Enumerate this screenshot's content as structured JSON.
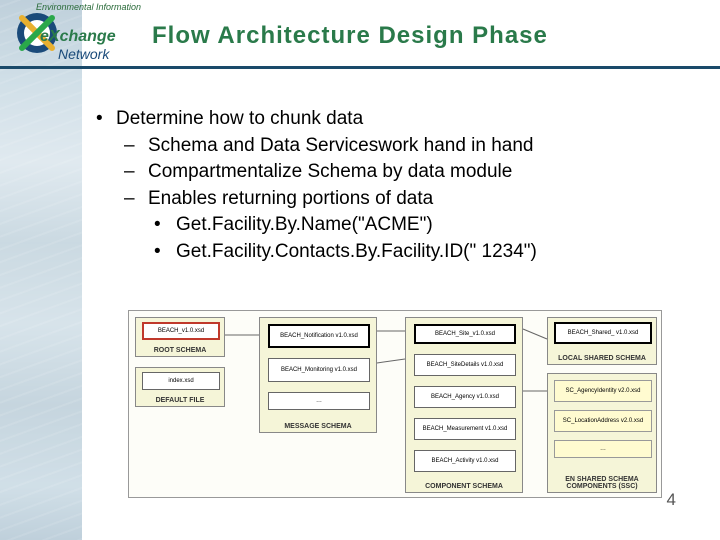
{
  "header": {
    "env_text": "Environmental Information",
    "logo_brand": "eXchange",
    "logo_sub": "Network",
    "title": "Flow Architecture Design Phase"
  },
  "bullets": {
    "b1": "Determine how to chunk data",
    "d1": "Schema and Data Serviceswork hand in hand",
    "d2": "Compartmentalize Schema by data module",
    "d3": "Enables returning portions of data",
    "s1": "Get.Facility.By.Name(\"ACME\")",
    "s2": "Get.Facility.Contacts.By.Facility.ID(\" 1234\")"
  },
  "diagram": {
    "g1": {
      "label": "ROOT SCHEMA",
      "box1": "BEACH_v1.0.xsd"
    },
    "g2": {
      "label": "DEFAULT FILE",
      "box1": "index.xsd"
    },
    "g3": {
      "label": "MESSAGE SCHEMA",
      "box1": "BEACH_Notification v1.0.xsd",
      "box2": "BEACH_Monitoring v1.0.xsd",
      "box3": "…"
    },
    "g4": {
      "label": "COMPONENT SCHEMA",
      "box1": "BEACH_Site_v1.0.xsd",
      "box2": "BEACH_SiteDetails v1.0.xsd",
      "box3": "BEACH_Agency v1.0.xsd",
      "box4": "BEACH_Measurement v1.0.xsd",
      "box5": "BEACH_Activity v1.0.xsd"
    },
    "g5": {
      "label": "LOCAL SHARED SCHEMA",
      "box1": "BEACH_Shared_ v1.0.xsd"
    },
    "g6": {
      "label": "EN SHARED SCHEMA COMPONENTS (SSC)",
      "box1": "SC_AgencyIdentity v2.0.xsd",
      "box2": "SC_LocationAddress v2.0.xsd",
      "box3": "…"
    }
  },
  "page": "4"
}
